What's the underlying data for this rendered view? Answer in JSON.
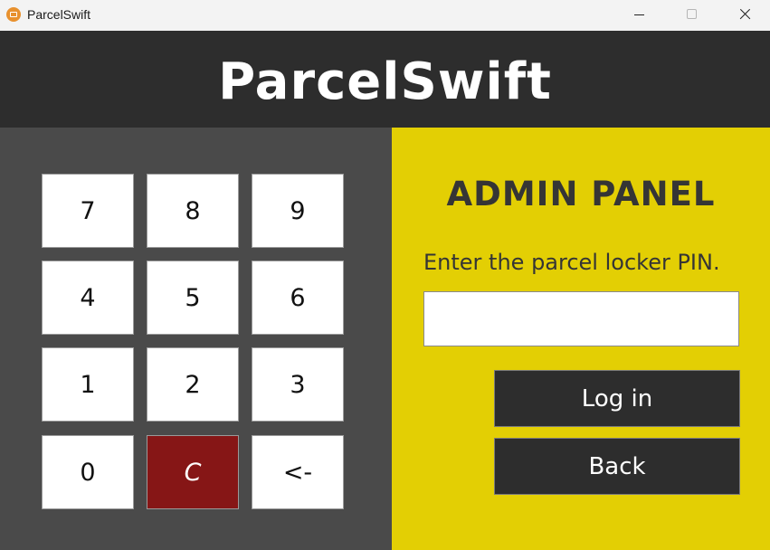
{
  "window": {
    "title": "ParcelSwift",
    "icon": "parcel-app-icon",
    "controls": [
      "minimize-icon",
      "maximize-icon",
      "close-icon"
    ]
  },
  "header": {
    "title": "ParcelSwift"
  },
  "keypad": {
    "keys": [
      "7",
      "8",
      "9",
      "4",
      "5",
      "6",
      "1",
      "2",
      "3",
      "0",
      "C",
      "<-"
    ]
  },
  "admin": {
    "title": "ADMIN PANEL",
    "prompt": "Enter the parcel locker PIN.",
    "pin_value": "",
    "login_label": "Log in",
    "back_label": "Back"
  },
  "colors": {
    "header_bg": "#2d2d2d",
    "keypad_bg": "#4a4a4a",
    "admin_bg": "#e3cf04",
    "clear_key": "#861616",
    "button_dark": "#2d2d2d"
  }
}
